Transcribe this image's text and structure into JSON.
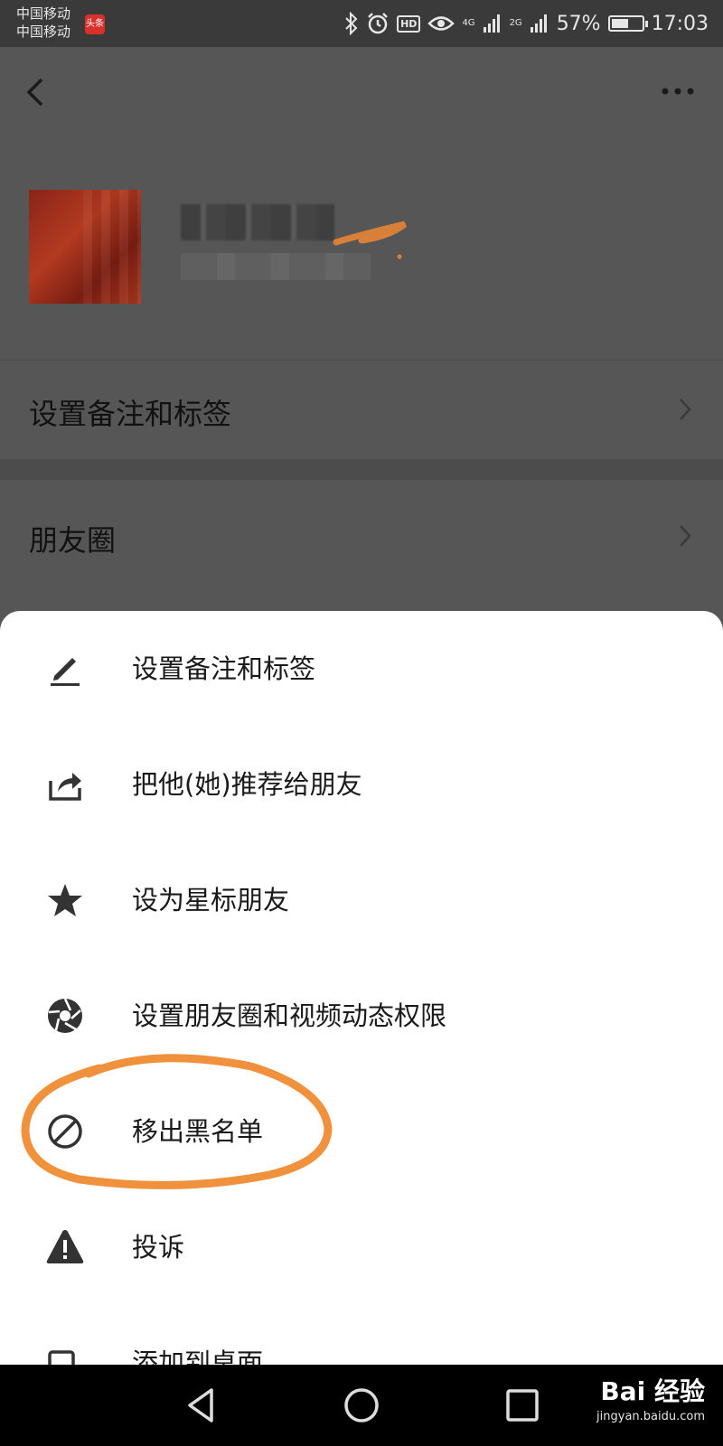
{
  "status_bar": {
    "carrier_1": "中国移动",
    "carrier_2": "中国移动",
    "news_badge": "头条",
    "net_1": "4G",
    "net_2": "2G",
    "battery_percent": "57%",
    "battery_level": 0.57,
    "time": "17:03",
    "icons": [
      "bluetooth-icon",
      "alarm-icon",
      "hd-icon",
      "eye-icon",
      "signal-icon",
      "battery-icon"
    ]
  },
  "page": {
    "rows": [
      {
        "label": "设置备注和标签"
      },
      {
        "label": "朋友圈"
      }
    ]
  },
  "sheet": {
    "items": [
      {
        "label": "设置备注和标签",
        "icon": "edit-icon"
      },
      {
        "label": "把他(她)推荐给朋友",
        "icon": "share-icon"
      },
      {
        "label": "设为星标朋友",
        "icon": "star-icon"
      },
      {
        "label": "设置朋友圈和视频动态权限",
        "icon": "aperture-icon"
      },
      {
        "label": "移出黑名单",
        "icon": "block-icon"
      },
      {
        "label": "投诉",
        "icon": "warning-icon"
      },
      {
        "label": "添加到桌面",
        "icon": "add-to-desktop-icon"
      }
    ]
  },
  "watermark": {
    "brand": "Bai 经验",
    "url": "jingyan.baidu.com"
  },
  "colors": {
    "highlight": "#f0913e",
    "sheet_bg": "#ffffff",
    "overlay": "#565656"
  }
}
